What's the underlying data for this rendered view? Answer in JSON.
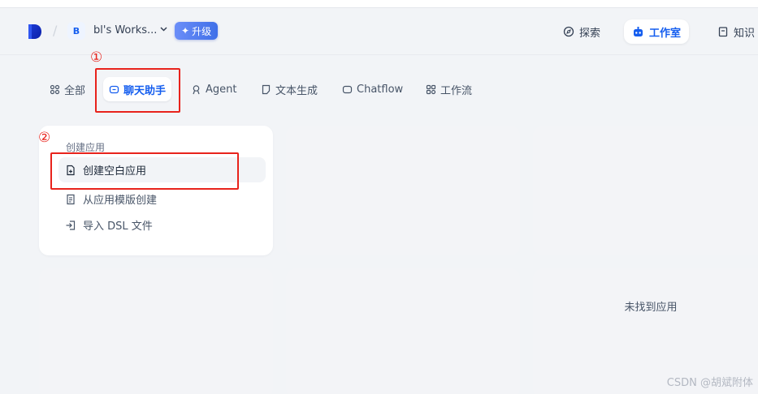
{
  "header": {
    "workspace_initial": "B",
    "workspace_name": "bl's Works...",
    "upgrade_label": "升级",
    "nav": {
      "explore": "探索",
      "studio": "工作室",
      "knowledge": "知识"
    }
  },
  "tabs": {
    "all": "全部",
    "chat_assistant": "聊天助手",
    "agent": "Agent",
    "text_generation": "文本生成",
    "chatflow": "Chatflow",
    "workflow": "工作流"
  },
  "create_card": {
    "title": "创建应用",
    "blank": "创建空白应用",
    "from_template": "从应用模版创建",
    "import_dsl": "导入 DSL 文件"
  },
  "empty_state": "未找到应用",
  "annotations": {
    "one": "①",
    "two": "②"
  },
  "watermark": "CSDN @胡斌附体",
  "colors": {
    "accent": "#155eef",
    "annotation": "#e8231c"
  }
}
